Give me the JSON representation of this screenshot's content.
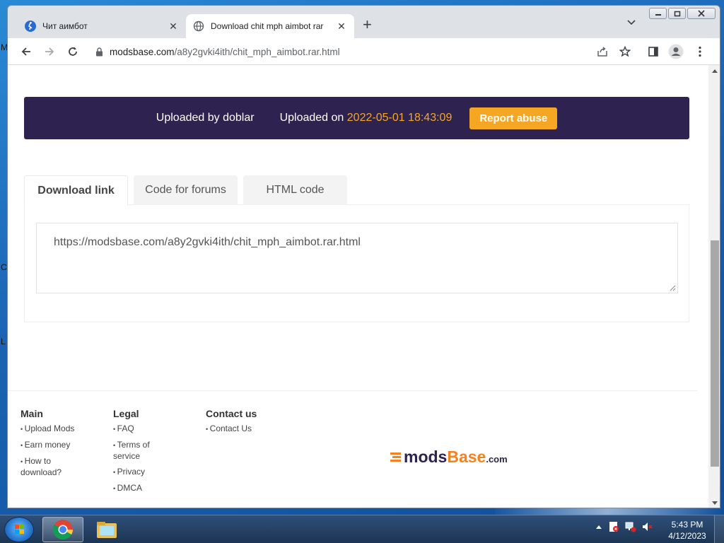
{
  "browser": {
    "tabs": [
      {
        "title": "Чит аимбот",
        "active": false
      },
      {
        "title": "Download chit mph aimbot rar",
        "active": true
      }
    ],
    "url_domain": "modsbase.com",
    "url_path": "/a8y2gvki4ith/chit_mph_aimbot.rar.html"
  },
  "desktop": {
    "edge_letters": [
      "M",
      "C",
      "L"
    ]
  },
  "banner": {
    "uploaded_by": "Uploaded by doblar",
    "uploaded_on_label": "Uploaded on",
    "uploaded_on_date": "2022-05-01 18:43:09",
    "report_label": "Report abuse"
  },
  "tabs_panel": {
    "tabs": [
      "Download link",
      "Code for forums",
      "HTML code"
    ],
    "link_value": "https://modsbase.com/a8y2gvki4ith/chit_mph_aimbot.rar.html"
  },
  "footer": {
    "columns": [
      {
        "title": "Main",
        "items": [
          "Upload Mods",
          "Earn money",
          "How to download?"
        ]
      },
      {
        "title": "Legal",
        "items": [
          "FAQ",
          "Terms of service",
          "Privacy",
          "DMCA"
        ]
      },
      {
        "title": "Contact us",
        "items": [
          "Contact Us"
        ]
      }
    ],
    "logo": {
      "part1": "mods",
      "part2": "Base",
      "part3": ".com"
    }
  },
  "taskbar": {
    "time": "5:43 PM",
    "date": "4/12/2023"
  },
  "colors": {
    "banner_bg": "#2e2350",
    "accent_orange": "#f5a623",
    "logo_orange": "#f58220"
  }
}
